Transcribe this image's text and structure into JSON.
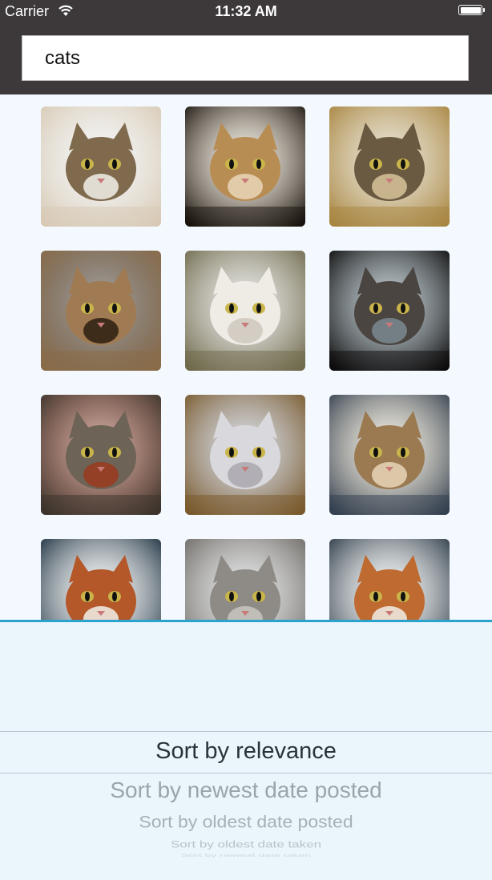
{
  "status_bar": {
    "carrier": "Carrier",
    "time": "11:32 AM"
  },
  "search": {
    "value": "cats"
  },
  "photos": [
    {
      "name": "cat-photo-1",
      "palette": {
        "bg": "#d8c9b5",
        "fur": "#7f6a4e",
        "accent": "#f2f0ea"
      }
    },
    {
      "name": "cat-photo-2",
      "palette": {
        "bg": "#1a140f",
        "fur": "#b88d53",
        "accent": "#e9d6b8"
      }
    },
    {
      "name": "cat-photo-3",
      "palette": {
        "bg": "#a88541",
        "fur": "#6b5a42",
        "accent": "#d7c49a"
      }
    },
    {
      "name": "cat-photo-4",
      "palette": {
        "bg": "#8a6b48",
        "fur": "#a07a52",
        "accent": "#2b1e11"
      }
    },
    {
      "name": "cat-photo-5",
      "palette": {
        "bg": "#6f6a4c",
        "fur": "#efece6",
        "accent": "#cfc8bd"
      }
    },
    {
      "name": "cat-photo-6",
      "palette": {
        "bg": "#0d0c0c",
        "fur": "#4b4542",
        "accent": "#7a8a90"
      }
    },
    {
      "name": "cat-photo-7",
      "palette": {
        "bg": "#3b342c",
        "fur": "#6d6356",
        "accent": "#9b3a1e"
      }
    },
    {
      "name": "cat-photo-8",
      "palette": {
        "bg": "#7a5a2c",
        "fur": "#d9d8dc",
        "accent": "#a9a8ae"
      }
    },
    {
      "name": "cat-photo-9",
      "palette": {
        "bg": "#33404f",
        "fur": "#9b7a52",
        "accent": "#e7d6b8"
      }
    },
    {
      "name": "cat-photo-10",
      "palette": {
        "bg": "#1c3040",
        "fur": "#b4582a",
        "accent": "#f2efe9"
      }
    },
    {
      "name": "cat-photo-11",
      "palette": {
        "bg": "#6e6b67",
        "fur": "#8e8a85",
        "accent": "#c9c5c0"
      }
    },
    {
      "name": "cat-photo-12",
      "palette": {
        "bg": "#2a3946",
        "fur": "#bf6a30",
        "accent": "#f1ede7"
      }
    }
  ],
  "sort_picker": {
    "options": [
      "Sort by relevance",
      "Sort by newest date posted",
      "Sort by oldest date posted",
      "Sort by oldest date taken",
      "Sort by newest date taken"
    ],
    "selected_index": 0
  },
  "colors": {
    "header_bg": "#3d393a",
    "accent_line": "#2aa3cf",
    "picker_bg": "#ebf5fc"
  }
}
